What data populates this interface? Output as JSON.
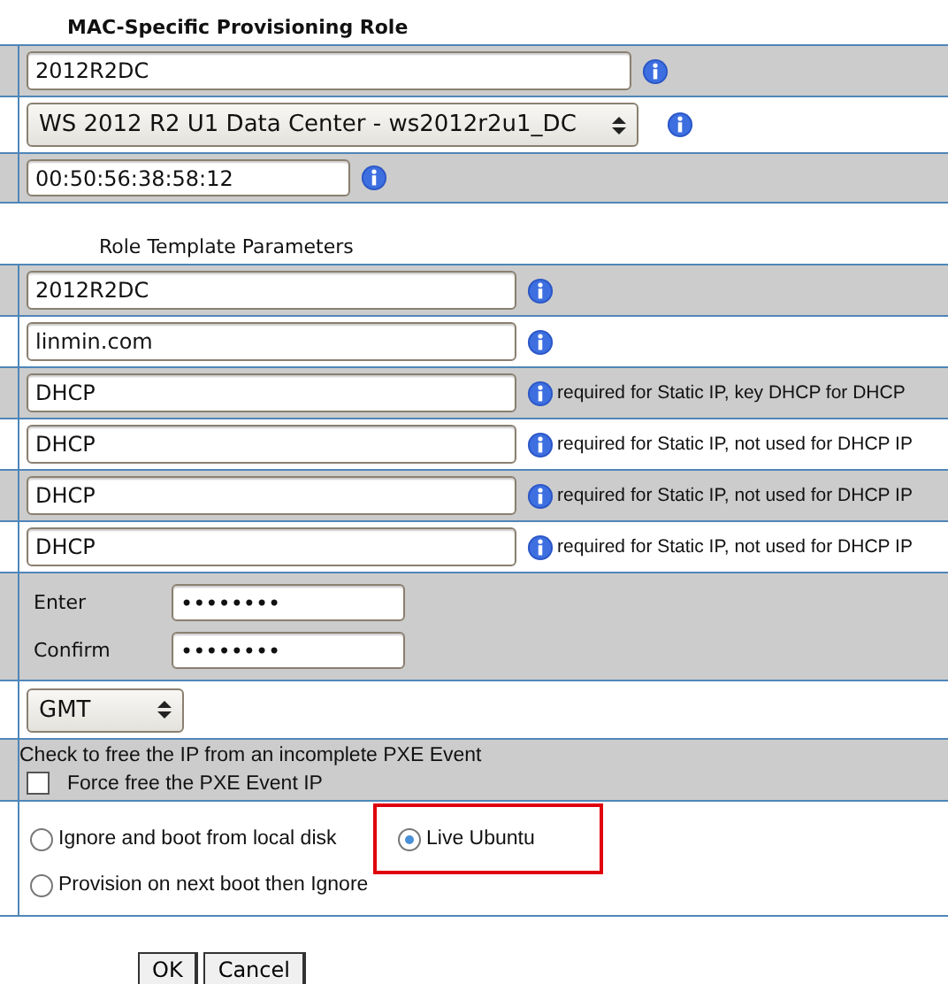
{
  "mac_section": {
    "heading": "MAC-Specific Provisioning Role",
    "fields": [
      {
        "kind": "text",
        "value": "2012R2DC"
      },
      {
        "kind": "select",
        "value": "WS 2012 R2 U1 Data Center - ws2012r2u1_DC"
      },
      {
        "kind": "text",
        "value": "00:50:56:38:58:12"
      }
    ]
  },
  "template_section": {
    "heading": "Role Template Parameters",
    "fields": [
      {
        "value": "2012R2DC"
      },
      {
        "value": "linmin.com"
      },
      {
        "value": "DHCP",
        "note": "required for Static IP, key DHCP for DHCP"
      },
      {
        "value": "DHCP",
        "note": "required for Static IP, not used for DHCP IP"
      },
      {
        "value": "DHCP",
        "note": "required for Static IP, not used for DHCP IP"
      },
      {
        "value": "DHCP",
        "note": "required for Static IP, not used for DHCP IP"
      }
    ]
  },
  "password": [
    {
      "label": "Enter",
      "value": "••••••••"
    },
    {
      "label": "Confirm",
      "value": "••••••••"
    }
  ],
  "timezone": {
    "value": "GMT"
  },
  "pxe": {
    "text": "Check to free the IP from an incomplete PXE Event",
    "checkbox": {
      "label": "Force free the PXE Event IP",
      "checked": false
    }
  },
  "boot_options": [
    {
      "label": "Ignore and boot from local disk",
      "selected": false,
      "highlighted": false
    },
    {
      "label": "Live Ubuntu",
      "selected": true,
      "highlighted": true
    },
    {
      "label": "Provision on next boot then Ignore",
      "selected": false,
      "highlighted": false
    }
  ],
  "buttons": [
    "OK",
    "Cancel"
  ]
}
